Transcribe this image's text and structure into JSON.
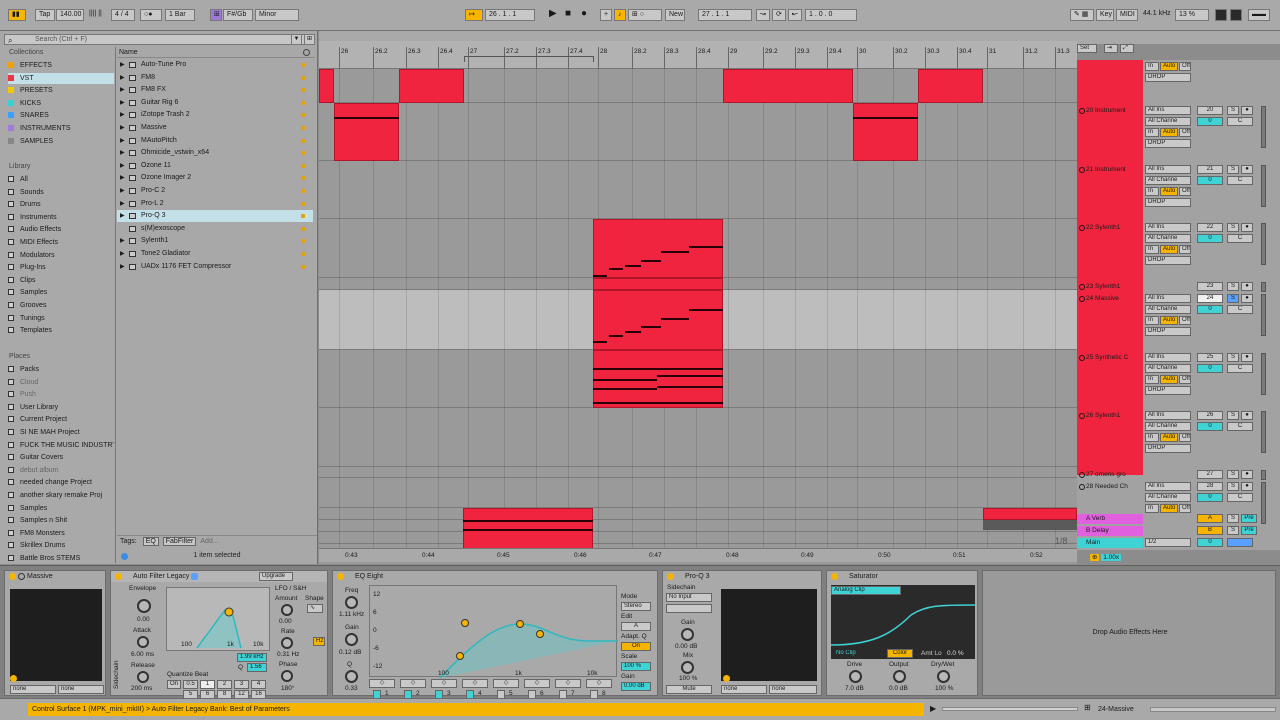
{
  "transport": {
    "tap": "Tap",
    "tempo": "140.00",
    "signature": "4 / 4",
    "quantize": "1 Bar",
    "key": "F#/Gb",
    "scale": "Minor",
    "position": "26 .  1 .  1",
    "new_label": "New",
    "loop_start": "27 .  1 .  1",
    "loop_length": "1 .  0 .  0",
    "key_label": "Key",
    "midi_label": "MIDI",
    "sample_rate": "44.1 kHz",
    "cpu": "13 %"
  },
  "browser": {
    "search_placeholder": "Search (Ctrl + F)",
    "collections_title": "Collections",
    "collections": [
      {
        "label": "EFFECTS",
        "color": "#f4a000"
      },
      {
        "label": "VST",
        "color": "#ee3344"
      },
      {
        "label": "PRESETS",
        "color": "#f5c800"
      },
      {
        "label": "KICKS",
        "color": "#34d3d3"
      },
      {
        "label": "SNARES",
        "color": "#3aa0ff"
      },
      {
        "label": "INSTRUMENTS",
        "color": "#a27bd8"
      },
      {
        "label": "SAMPLES",
        "color": "#888888"
      }
    ],
    "library_title": "Library",
    "library": [
      "All",
      "Sounds",
      "Drums",
      "Instruments",
      "Audio Effects",
      "MIDI Effects",
      "Modulators",
      "Plug-Ins",
      "Clips",
      "Samples",
      "Grooves",
      "Tunings",
      "Templates"
    ],
    "places_title": "Places",
    "places": [
      "Packs",
      "Cloud",
      "Push",
      "User Library",
      "Current Project",
      "SI NE MAH Project",
      "FUCK THE MUSIC INDUSTR'",
      "Guitar Covers",
      "debut album",
      "needed change Project",
      "another skary remake Proj",
      "Samples",
      "Samples n Shit",
      "FM8 Monsters",
      "Skrillex Drums",
      "Battle Bros STEMS"
    ],
    "name_header": "Name",
    "files": [
      "Auto-Tune Pro",
      "FM8",
      "FM8 FX",
      "Guitar Rig 6",
      "iZotope Trash 2",
      "Massive",
      "MAutoPitch",
      "Ohmicide_vstwin_x64",
      "Ozone 11",
      "Ozone Imager 2",
      "Pro-C 2",
      "Pro-L 2",
      "Pro-Q 3",
      "s(M)exoscope",
      "Sylenth1",
      "Tone2 Gladiator",
      "UADx 1176 FET Compressor"
    ],
    "selected_file": "Pro-Q 3",
    "tags_label": "Tags:",
    "tags": [
      "EQ",
      "FabFilter",
      "Add..."
    ],
    "selection_status": "1 item selected"
  },
  "ruler": {
    "bars": [
      "26",
      "26.2",
      "26.3",
      "26.4",
      "27",
      "27.2",
      "27.3",
      "27.4",
      "28",
      "28.2",
      "28.3",
      "28.4",
      "29",
      "29.2",
      "29.3",
      "29.4",
      "30",
      "30.2",
      "30.3",
      "30.4",
      "31",
      "31.2",
      "31.3"
    ],
    "times": [
      "0:43",
      "0:44",
      "0:45",
      "0:46",
      "0:47",
      "0:48",
      "0:49",
      "0:50",
      "0:51",
      "0:52"
    ],
    "set_label": "Set",
    "grid": "1/8"
  },
  "tracks": [
    {
      "name": "20 Instrument",
      "num": "20",
      "input": "All Ins",
      "channel": "All Channe",
      "out": "DROP"
    },
    {
      "name": "21 Instrument",
      "num": "21",
      "input": "All Ins",
      "channel": "All Channe",
      "out": "DROP"
    },
    {
      "name": "22 Sylenth1",
      "num": "22",
      "input": "All Ins",
      "channel": "All Channe",
      "out": "DROP"
    },
    {
      "name": "23 Sylenth1",
      "num": "23",
      "input": "",
      "channel": "",
      "out": ""
    },
    {
      "name": "24 Massive",
      "num": "24",
      "input": "All Ins",
      "channel": "All Channe",
      "out": "DROP"
    },
    {
      "name": "25 Synthetic C",
      "num": "25",
      "input": "All Ins",
      "channel": "All Channe",
      "out": "DROP"
    },
    {
      "name": "26 Sylenth1",
      "num": "26",
      "input": "All Ins",
      "channel": "All Channe",
      "out": "DROP"
    },
    {
      "name": "27 omens gro",
      "num": "27",
      "input": "",
      "channel": "",
      "out": ""
    },
    {
      "name": "28 Needed Ch",
      "num": "28",
      "input": "All Ins",
      "channel": "All Channe",
      "out": ""
    }
  ],
  "returns": [
    {
      "name": "A Verb",
      "letter": "A",
      "pre": "Pre"
    },
    {
      "name": "B Delay",
      "letter": "B",
      "pre": "Pre"
    },
    {
      "name": "Main",
      "letter": "",
      "pre": ""
    }
  ],
  "mixer_labels": {
    "in": "In",
    "auto": "Auto",
    "off": "Off",
    "neg_inf": "-∞",
    "zero": "0",
    "c": "C",
    "s": "S",
    "main_ratio": "1/2",
    "zoom": "1.00x"
  },
  "devices": {
    "massive": {
      "title": "Massive",
      "sel1": "none",
      "sel2": "none"
    },
    "autofilter": {
      "title": "Auto Filter Legacy",
      "upgrade": "Upgrade",
      "envelope": "Envelope",
      "env_val": "0.00",
      "attack": "Attack",
      "attack_val": "6.00 ms",
      "release": "Release",
      "release_val": "200 ms",
      "freq": "1.99 kHz",
      "q": "Q",
      "q_val": "1.56",
      "freq_axis": [
        "100",
        "1k",
        "10k"
      ],
      "lfo": "LFO / S&H",
      "amount": "Amount",
      "shape": "Shape",
      "amount_val": "0.00",
      "rate": "Rate",
      "rate_val": "0.31 Hz",
      "phase": "Phase",
      "phase_val": "180°",
      "hz": "Hz",
      "quantize": "Quantize Beat",
      "on": "On",
      "beats": [
        "0.5",
        "1",
        "2",
        "3",
        "4",
        "5",
        "6",
        "8",
        "12",
        "16"
      ],
      "sidechain": "Sidechain"
    },
    "eq": {
      "title": "EQ Eight",
      "freq": "Freq",
      "freq_val": "1.11 kHz",
      "gain": "Gain",
      "gain_val": "0.12 dB",
      "q": "Q",
      "q_val": "0.33",
      "db_axis": [
        "12",
        "6",
        "0",
        "-6",
        "-12"
      ],
      "freq_axis": [
        "100",
        "1k",
        "10k"
      ],
      "mode": "Mode",
      "mode_val": "Stereo",
      "edit": "Edit",
      "edit_val": "A",
      "adapt": "Adapt. Q",
      "adapt_val": "On",
      "scale": "Scale",
      "scale_val": "100 %",
      "gain_out": "Gain",
      "gain_out_val": "0.00 dB",
      "bands": [
        "1",
        "2",
        "3",
        "4",
        "5",
        "6",
        "7",
        "8"
      ]
    },
    "proq": {
      "title": "Pro-Q 3",
      "sidechain": "Sidechain",
      "sc_input": "No Input",
      "gain": "Gain",
      "gain_val": "0.00 dB",
      "mix": "Mix",
      "mix_val": "100 %",
      "mute": "Mute",
      "sel1": "none",
      "sel2": "none"
    },
    "saturator": {
      "title": "Saturator",
      "type": "Analog Clip",
      "noclip": "No Clip",
      "color": "Color",
      "amt": "Amt Lo",
      "amt_val": "0.0 %",
      "drive": "Drive",
      "drive_val": "7.0 dB",
      "output": "Output",
      "output_val": "0.0 dB",
      "drywet": "Dry/Wet",
      "drywet_val": "100 %"
    },
    "drop": "Drop Audio Effects Here"
  },
  "status": {
    "message": "Control Surface 1 (MPK_mini_mkIII) > Auto Filter Legacy Bank: Best of Parameters",
    "track": "24-Massive"
  },
  "colors": {
    "clip": "#f0243e",
    "accent": "#f5b400",
    "cyan": "#3fd3d6",
    "return": "#e060e0"
  }
}
